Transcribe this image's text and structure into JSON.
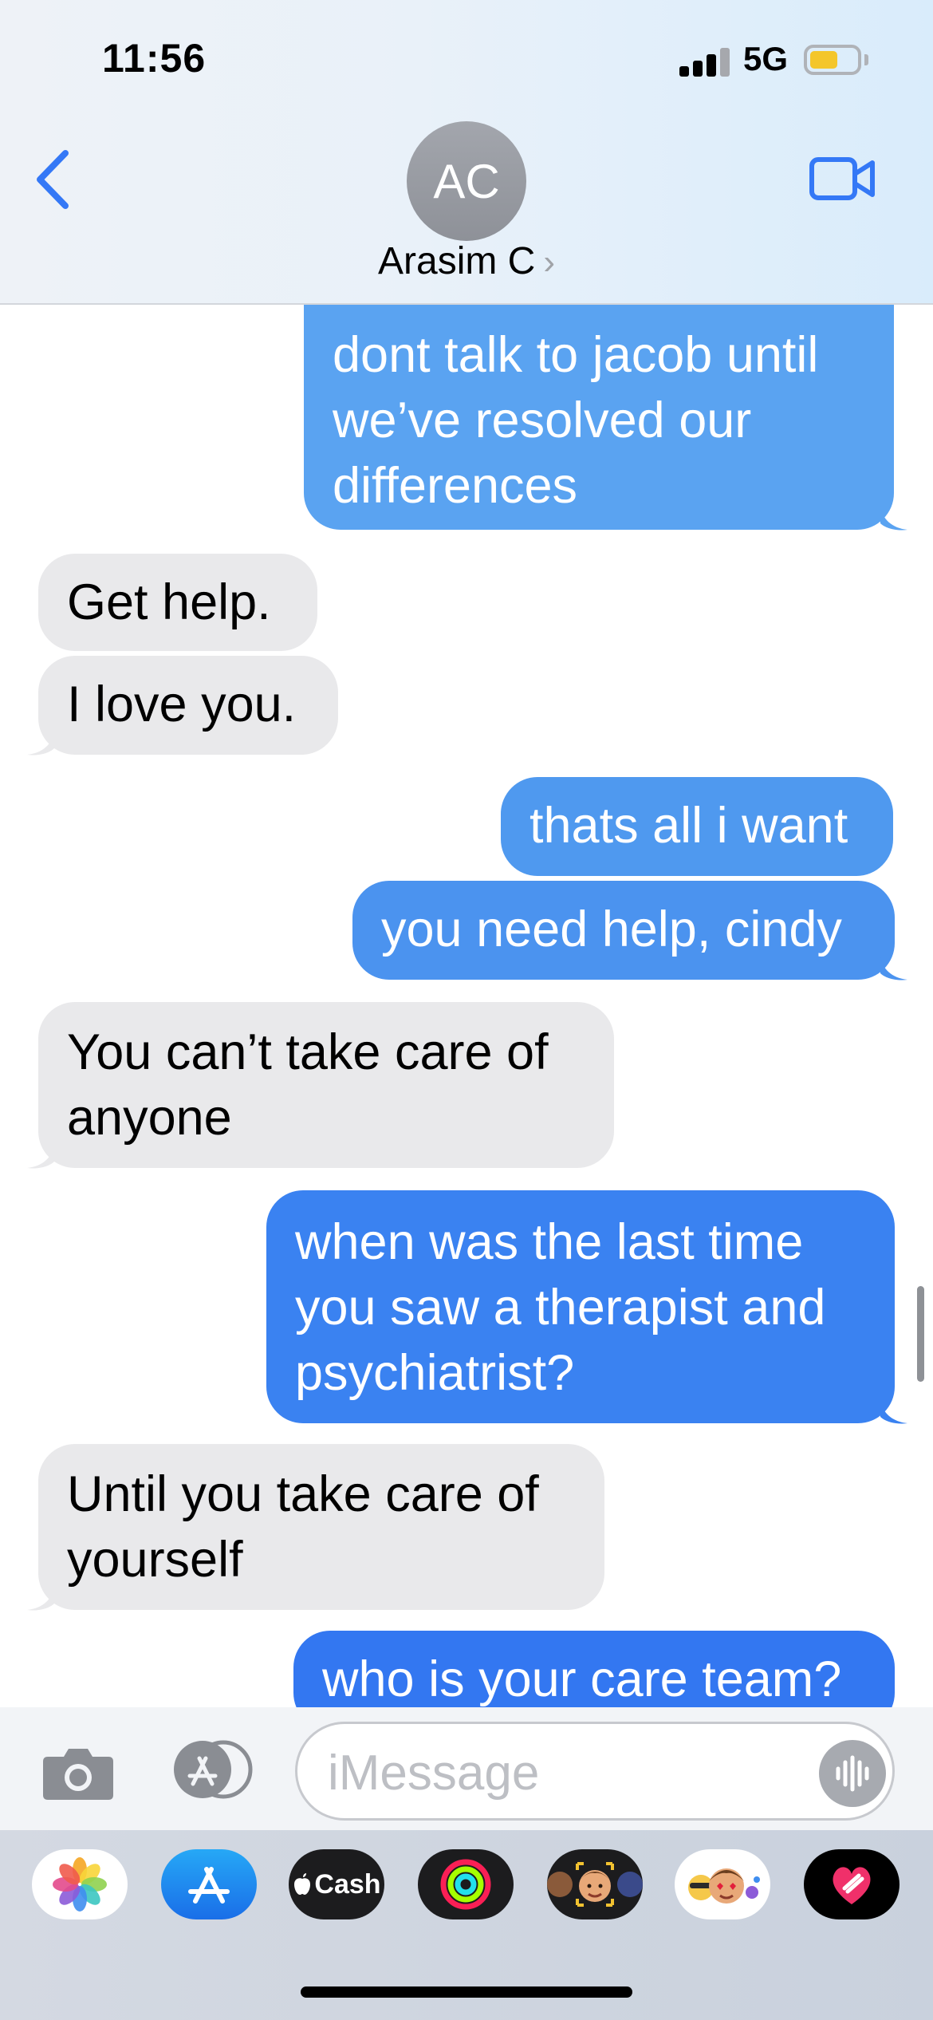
{
  "status_bar": {
    "time": "11:56",
    "network": "5G",
    "battery_level_percent": 60,
    "battery_color": "#f4c62b"
  },
  "header": {
    "back_icon": "chevron-left-icon",
    "avatar_initials": "AC",
    "contact_name": "Arasim C",
    "contact_chevron": "›",
    "video_icon": "video-camera-icon",
    "accent_color": "#3478f6"
  },
  "messages": [
    {
      "direction": "sent",
      "text": "dont talk to jacob until we’ve resolved our differences",
      "color": "#5aa3f1"
    },
    {
      "direction": "received",
      "text": "Get help."
    },
    {
      "direction": "received",
      "text": "I love you."
    },
    {
      "direction": "sent",
      "text": "thats all i want",
      "color": "#4f99ef"
    },
    {
      "direction": "sent",
      "text": "you need help, cindy",
      "color": "#4b93ef"
    },
    {
      "direction": "received",
      "text": "You can’t take care of anyone"
    },
    {
      "direction": "sent",
      "text": "when was the last time you saw a therapist and psychiatrist?",
      "color": "#3a82f1"
    },
    {
      "direction": "received",
      "text": "Until you take care of yourself"
    },
    {
      "direction": "sent",
      "text": "who is your care team?",
      "color": "#3377f1"
    }
  ],
  "input_bar": {
    "camera_icon": "camera-icon",
    "apps_icon": "app-store-icon",
    "placeholder": "iMessage",
    "voice_icon": "waveform-icon"
  },
  "app_drawer": {
    "apps": [
      {
        "name": "photos-icon"
      },
      {
        "name": "app-store-icon"
      },
      {
        "name": "apple-cash-icon",
        "label": "Cash"
      },
      {
        "name": "fitness-rings-icon"
      },
      {
        "name": "memoji-icon"
      },
      {
        "name": "memoji-stickers-icon"
      },
      {
        "name": "digital-touch-icon"
      }
    ]
  }
}
